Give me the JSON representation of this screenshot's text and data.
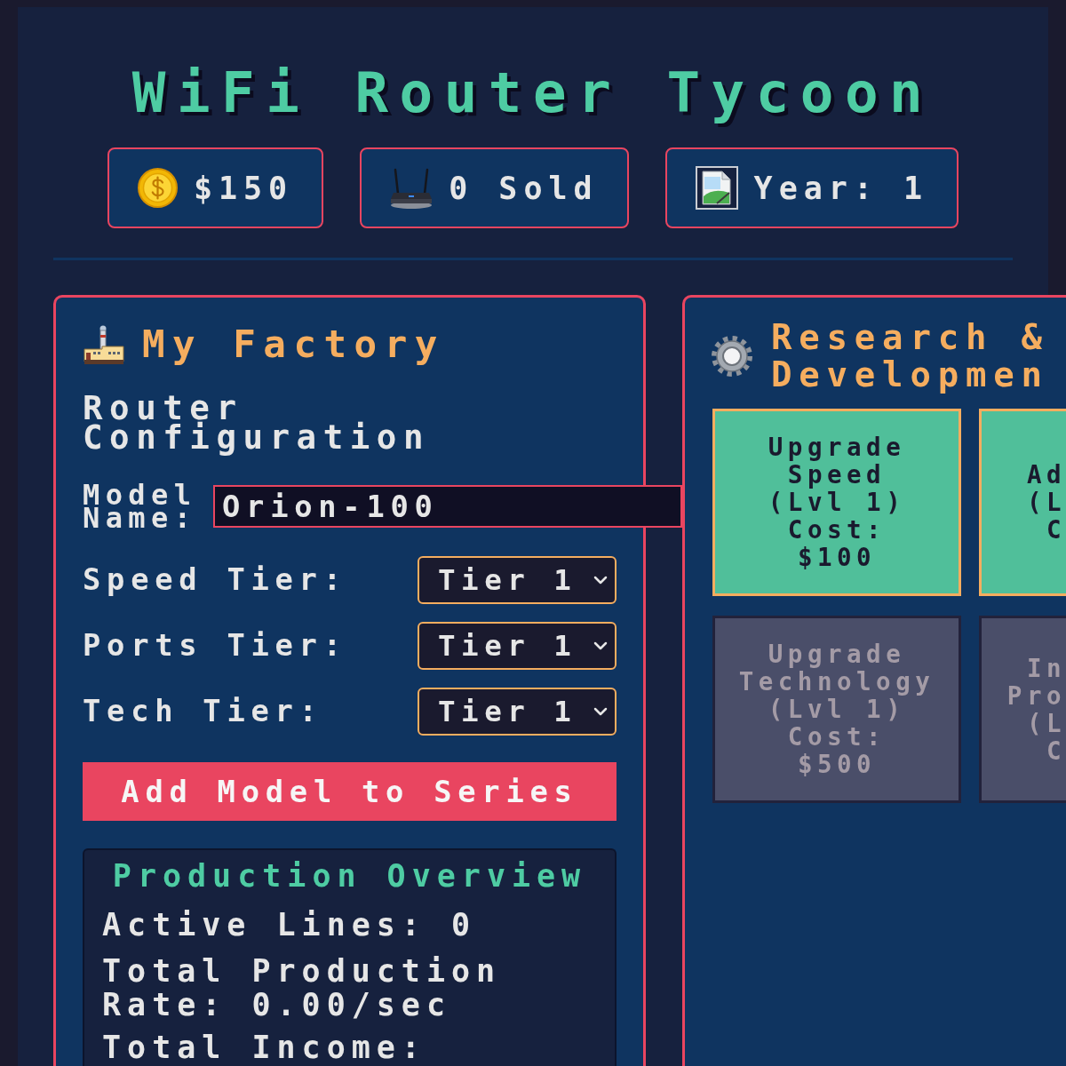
{
  "title": "WiFi Router Tycoon",
  "stats": [
    {
      "kind": "money",
      "text": "$150"
    },
    {
      "kind": "sold",
      "text": "0 Sold"
    },
    {
      "kind": "year",
      "text": "Year: 1"
    }
  ],
  "factory": {
    "heading": "My Factory",
    "config_heading": "Router Configuration",
    "model_name": {
      "label": "Model Name:",
      "value": "Orion-100"
    },
    "tiers": [
      {
        "label": "Speed Tier:",
        "value": "Tier 1"
      },
      {
        "label": "Ports Tier:",
        "value": "Tier 1"
      },
      {
        "label": "Tech Tier:",
        "value": "Tier 1"
      }
    ],
    "add_button": "Add Model to Series",
    "overview": {
      "heading": "Production Overview",
      "lines": [
        "Active Lines: 0",
        "Total Production Rate: 0.00/sec",
        "Total Income:"
      ]
    }
  },
  "research": {
    "heading": "Research & Developmen",
    "upgrades": [
      {
        "lines": [
          "Upgrade",
          "Speed",
          "(Lvl 1)",
          "Cost:",
          "$100"
        ],
        "disabled": false
      },
      {
        "lines": [
          "Ad",
          "(L",
          "C"
        ],
        "disabled": false
      },
      {
        "lines": [
          "Upgrade",
          "Technology",
          "(Lvl 1)",
          "Cost:",
          "$500"
        ],
        "disabled": true
      },
      {
        "lines": [
          "In",
          "Pro",
          "(L",
          "C"
        ],
        "disabled": true
      }
    ]
  }
}
